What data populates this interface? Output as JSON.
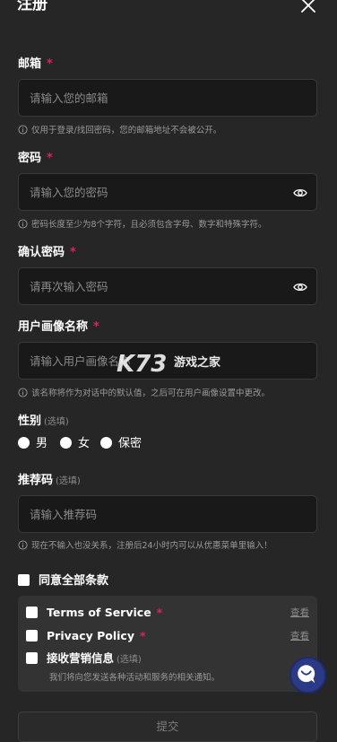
{
  "header": {
    "title": "注册"
  },
  "email": {
    "label": "邮箱",
    "placeholder": "请输入您的邮箱",
    "hint": "仅用于登录/找回密码，您的邮箱地址不会被公开。"
  },
  "password": {
    "label": "密码",
    "placeholder": "请输入您的密码",
    "hint": "密码长度至少为8个字符，且必须包含字母、数字和特殊字符。"
  },
  "confirm_password": {
    "label": "确认密码",
    "placeholder": "请再次输入密码"
  },
  "persona_name": {
    "label": "用户画像名称",
    "placeholder": "请输入用户画像名称",
    "hint": "该名称将作为对话中的默认值，之后可在用户画像设置中更改。"
  },
  "gender": {
    "label": "性别",
    "optional": "(选填)",
    "options": [
      "男",
      "女",
      "保密"
    ]
  },
  "referral": {
    "label": "推荐码",
    "optional": "(选填)",
    "placeholder": "请输入推荐码",
    "hint": "现在不输入也没关系，注册后24小时内可以从优惠菜单里输入！"
  },
  "agree_all": "同意全部条款",
  "terms": [
    {
      "label": "Terms of Service",
      "view": "查看"
    },
    {
      "label": "Privacy Policy",
      "view": "查看"
    },
    {
      "label": "接收营销信息",
      "optional": "(选填)",
      "sub": "我们将向您发送各种活动和服务的相关通知。"
    }
  ],
  "required_mark": "*",
  "submit_label": "提交",
  "watermark": {
    "brand": "K73",
    "text": "游戏之家"
  },
  "colors": {
    "background": "#262626",
    "input_bg": "#191919",
    "required": "#e0215a",
    "chat_button": "#2a3a86"
  }
}
